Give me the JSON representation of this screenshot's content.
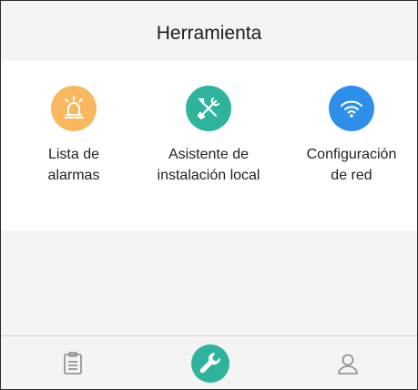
{
  "header": {
    "title": "Herramienta"
  },
  "tools": [
    {
      "label": "Lista de\nalarmas",
      "icon": "alarm-siren-icon",
      "color": "#F7B860"
    },
    {
      "label": "Asistente de\ninstalación local",
      "icon": "tools-icon",
      "color": "#2FB39D"
    },
    {
      "label": "Configuración\nde red",
      "icon": "wifi-icon",
      "color": "#2E8FE8"
    }
  ],
  "bottom_nav": {
    "items": [
      {
        "icon": "clipboard-icon",
        "active": false
      },
      {
        "icon": "wrench-icon",
        "active": true,
        "color": "#2FB39D"
      },
      {
        "icon": "user-icon",
        "active": false
      }
    ]
  }
}
